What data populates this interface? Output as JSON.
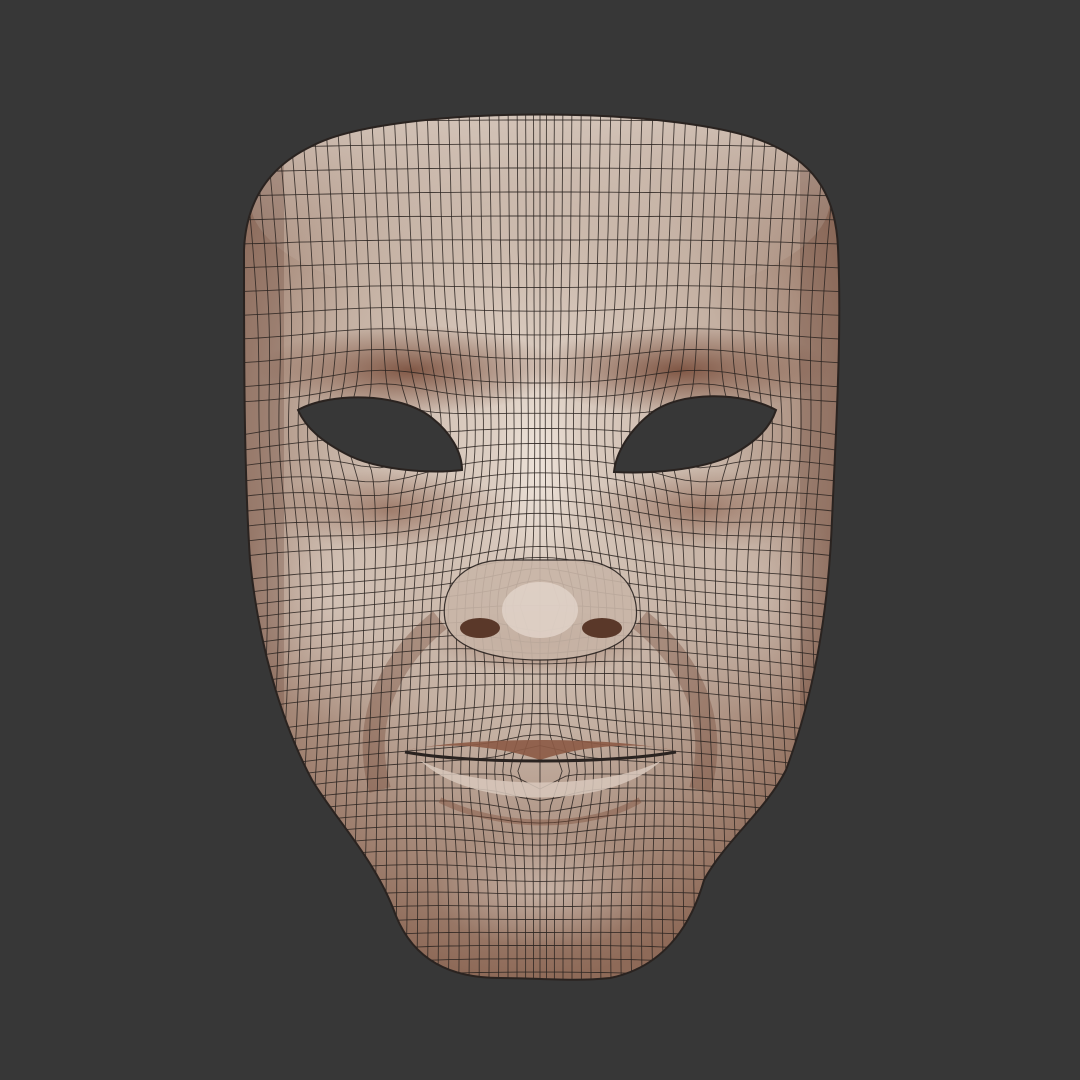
{
  "scene": {
    "subject": "mask-wireframe-render",
    "colors": {
      "background": "#373737",
      "skin_base": "#b39f92",
      "skin_highlight": "#e3d6cb",
      "skin_shadow": "#7a4e3a",
      "wire": "#2a2320",
      "hole": "#373737"
    }
  }
}
